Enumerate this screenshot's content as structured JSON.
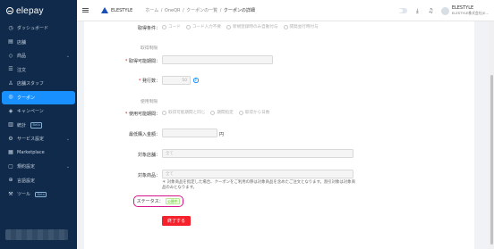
{
  "sidebar": {
    "logo": "elepay",
    "items": [
      {
        "label": "ダッシュボード",
        "icon": "dashboard-icon"
      },
      {
        "label": "店舗",
        "icon": "store-icon"
      },
      {
        "label": "商品",
        "icon": "tag-icon",
        "expandable": true
      },
      {
        "label": "注文",
        "icon": "order-icon"
      },
      {
        "label": "店舗スタッフ",
        "icon": "user-icon"
      },
      {
        "label": "クーポン",
        "icon": "coupon-icon",
        "active": true
      },
      {
        "label": "キャンペーン",
        "icon": "campaign-icon"
      },
      {
        "label": "統計",
        "icon": "stats-icon",
        "badge": "Beta"
      },
      {
        "label": "サービス設定",
        "icon": "gear-icon",
        "expandable": true
      },
      {
        "label": "Marketplace",
        "icon": "grid-icon"
      },
      {
        "label": "規約設定",
        "icon": "doc-icon",
        "expandable": true
      },
      {
        "label": "言語設定",
        "icon": "globe-icon"
      },
      {
        "label": "ツール",
        "icon": "tool-icon",
        "badge": "Beta"
      }
    ]
  },
  "header": {
    "brand": "ELESTYLE",
    "breadcrumb": [
      "ホーム",
      "OneQR",
      "クーポンの一覧",
      "クーポンの詳細"
    ],
    "user_name": "ELESTYLE",
    "user_org": "ELESTYLE株式会社(E..."
  },
  "form": {
    "acquisition_condition_label": "取得条件：",
    "acquisition_options": [
      "コード",
      "コード入力不要",
      "新規登録時のみ自動付与",
      "開発並行時付与"
    ],
    "acquisition_limit_title": "取得制限",
    "acquisition_period_label": "取得可能期間：",
    "issue_count_label": "発行数：",
    "issue_count_value": "50",
    "usage_limit_title": "使用制限",
    "usage_period_label": "使用可能期間：",
    "usage_options": [
      "取得可能期間と同じ",
      "期間指定",
      "取得から日数"
    ],
    "min_purchase_label": "最低購入金額：",
    "currency_unit": "円",
    "target_store_label": "対象店舗：",
    "target_store_value": "全て",
    "target_product_label": "対象商品：",
    "target_product_value": "全て",
    "note": "＊ 対象商品を指定した場合、クーポンをご利用の際は対象商品を含めたご注文となります。割引対象は対象商品のみとなります。",
    "status_label": "ステータス：",
    "status_value": "公開中",
    "end_button": "終了する"
  },
  "colors": {
    "sidebar_bg": "#0f2a4a",
    "active": "#1890ff",
    "danger": "#f5222d",
    "status_highlight": "#d6158a",
    "status_green": "#52c41a"
  }
}
